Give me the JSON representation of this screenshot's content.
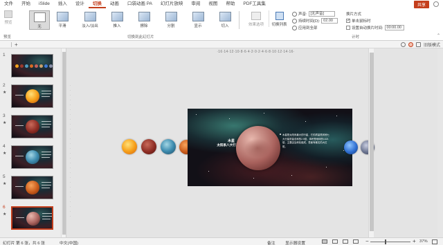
{
  "menu": {
    "tabs": [
      "文件",
      "开始",
      "iSlide",
      "插入",
      "设计",
      "切换",
      "动画",
      "口袋动画 PA",
      "幻灯片放映",
      "审阅",
      "视图",
      "帮助",
      "PDF工具集"
    ],
    "active_tab": "切换",
    "share_label": "共享"
  },
  "ribbon": {
    "preview_label": "预览",
    "preview_group": "预览",
    "transitions": [
      "无",
      "平滑",
      "淡入/淡出",
      "推入",
      "擦除",
      "分割",
      "显示",
      "切入"
    ],
    "selected_transition": "无",
    "transitions_group": "切换到此幻灯片",
    "effect_options_label": "效果选项",
    "switch_list_label": "切换列表",
    "sound_label": "声音:",
    "sound_value": "[无声音]",
    "duration_label": "持续时间(D):",
    "duration_value": "02.00",
    "apply_all_label": "应用到全部",
    "advance_title": "换片方式",
    "on_click_label": "单击鼠标时",
    "auto_after_label": "设置自动换片时间:",
    "auto_after_value": "00:00.00",
    "timing_group": "计时"
  },
  "toolbar": {
    "plus_label": "+",
    "presenter_label": "旧版模式"
  },
  "thumbnails": [
    {
      "num": "1",
      "star": ""
    },
    {
      "num": "2",
      "star": "★"
    },
    {
      "num": "3",
      "star": "★"
    },
    {
      "num": "4",
      "star": "★"
    },
    {
      "num": "5",
      "star": "★"
    },
    {
      "num": "6",
      "star": "★"
    }
  ],
  "rulers": {
    "horizontal": "·16·14·12·10·8·6·4·2·0·2·4·6·8·10·12·14·16·"
  },
  "slide": {
    "title_line1": "木星",
    "title_line2": "太阳系八大行星之一",
    "body": "木星是太阳系最大的行星，它的质量是其他七大行星质量总和的2.5倍，体积是地球的1321倍，主要由氢和氦组成，表面有著名的大红斑。"
  },
  "status": {
    "slide_info": "幻灯片 第 6 张，共 6 张",
    "language": "中文(中国)",
    "notes_label": "备注",
    "display_label": "显示器设置",
    "zoom": "37%"
  }
}
